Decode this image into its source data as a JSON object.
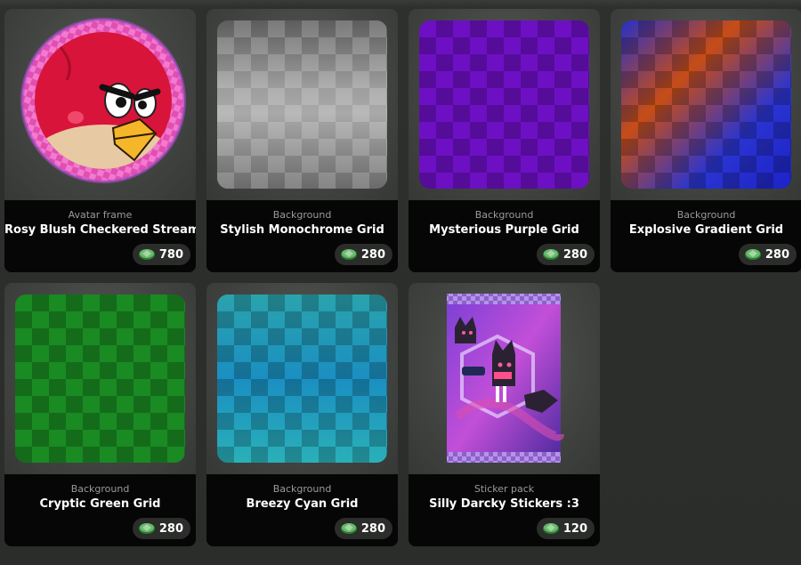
{
  "colors": {
    "card_bg": "#060606",
    "tile_bg": "#434543",
    "price_pill": "#2b2d2b",
    "coin_green": "#4caf50"
  },
  "items": [
    {
      "category": "Avatar frame",
      "name": "Rosy Blush Checkered Stream",
      "price": "780",
      "art": "red-bird-avatar-in-pink-checkered-frame"
    },
    {
      "category": "Background",
      "name": "Stylish Monochrome Grid",
      "price": "280",
      "art": "gray-checker-swatch"
    },
    {
      "category": "Background",
      "name": "Mysterious Purple Grid",
      "price": "280",
      "art": "purple-checker-swatch"
    },
    {
      "category": "Background",
      "name": "Explosive Gradient Grid",
      "price": "280",
      "art": "blue-orange-checker-swatch"
    },
    {
      "category": "Background",
      "name": "Cryptic Green Grid",
      "price": "280",
      "art": "green-checker-swatch"
    },
    {
      "category": "Background",
      "name": "Breezy Cyan Grid",
      "price": "280",
      "art": "cyan-checker-swatch"
    },
    {
      "category": "Sticker pack",
      "name": "Silly Darcky Stickers :3",
      "price": "120",
      "art": "sticker-pack-wrapper"
    }
  ],
  "currency_icon": "green-coin-icon"
}
